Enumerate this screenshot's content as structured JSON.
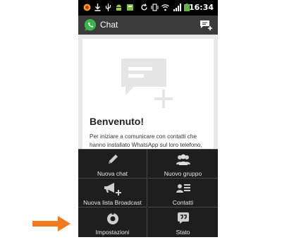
{
  "status_bar": {
    "time": "16:34"
  },
  "action_bar": {
    "title": "Chat",
    "icons": [
      "whatsapp-logo",
      "new-chat-icon"
    ]
  },
  "welcome": {
    "heading": "Benvenuto!",
    "text": "Per iniziare a comunicare con contatti che hanno installato WhatsApp sul loro telefono,"
  },
  "menu": {
    "new_chat": "Nuova chat",
    "new_group": "Nuovo gruppo",
    "new_broadcast": "Nuova lista Broadcast",
    "contacts": "Contatti",
    "settings": "Impostazioni",
    "status": "Stato"
  },
  "colors": {
    "accent": "#f47a20",
    "brand": "#3cb44a",
    "action_bar": "#3b3b3b",
    "menu": "#1e1e1e"
  }
}
